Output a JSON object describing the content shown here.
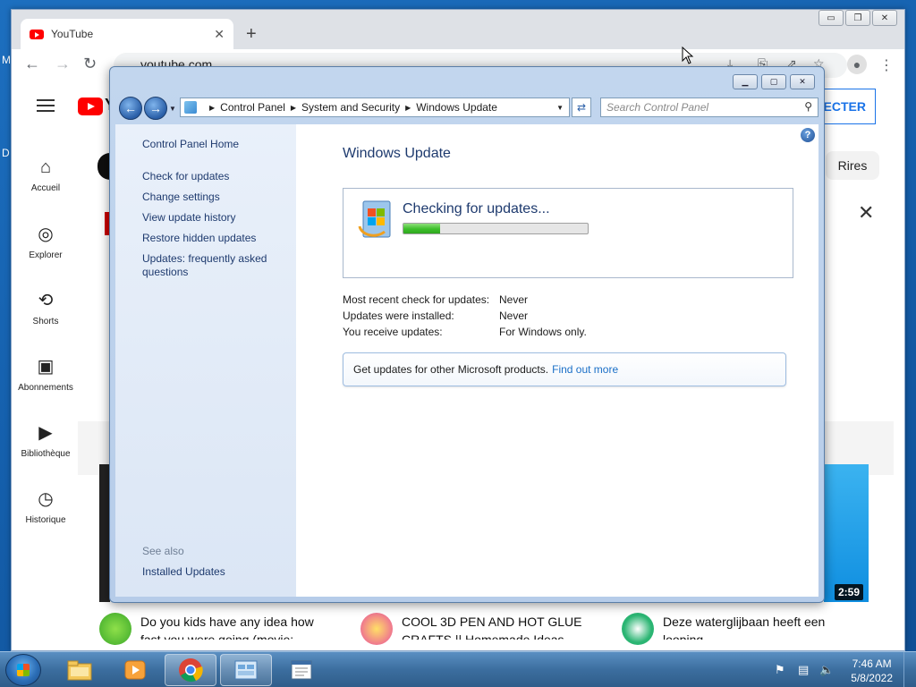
{
  "desktop": {
    "left_letter_1": "M",
    "left_letter_2": "D"
  },
  "browser": {
    "tab_title": "YouTube",
    "tab_close": "✕",
    "new_tab": "+",
    "url": "youtube.com",
    "caption": {
      "minimize": "▭",
      "restore": "❐",
      "close": "✕"
    }
  },
  "youtube": {
    "logo_letter": "Y",
    "connect_label": "ECTER",
    "chip_label": "Rires",
    "sidebar": [
      {
        "label": "Accueil",
        "icon": "home-icon"
      },
      {
        "label": "Explorer",
        "icon": "compass-icon"
      },
      {
        "label": "Shorts",
        "icon": "shorts-icon"
      },
      {
        "label": "Abonnements",
        "icon": "subscriptions-icon"
      },
      {
        "label": "Bibliothèque",
        "icon": "library-icon"
      },
      {
        "label": "Historique",
        "icon": "history-icon"
      }
    ],
    "video_duration": "2:59",
    "videos": [
      {
        "title": "Do you kids have any idea how fast you were going (movie:"
      },
      {
        "title": "COOL 3D PEN AND HOT GLUE CRAFTS || Homemade Ideas"
      },
      {
        "title": "Deze waterglijbaan heeft een looping"
      }
    ]
  },
  "control_panel": {
    "breadcrumb": [
      "Control Panel",
      "System and Security",
      "Windows Update"
    ],
    "search_placeholder": "Search Control Panel",
    "left_links": [
      "Control Panel Home",
      "Check for updates",
      "Change settings",
      "View update history",
      "Restore hidden updates",
      "Updates: frequently asked questions"
    ],
    "see_also_label": "See also",
    "see_also_links": [
      "Installed Updates"
    ],
    "title": "Windows Update",
    "status_text": "Checking for updates...",
    "progress_fraction": 0.2,
    "info": [
      {
        "label": "Most recent check for updates:",
        "value": "Never"
      },
      {
        "label": "Updates were installed:",
        "value": "Never"
      },
      {
        "label": "You receive updates:",
        "value": "For Windows only."
      }
    ],
    "promo_text": "Get updates for other Microsoft products.",
    "promo_link": "Find out more"
  },
  "taskbar": {
    "clock_time": "7:46 AM",
    "clock_date": "5/8/2022",
    "apps": [
      "explorer-icon",
      "media-player-icon",
      "chrome-icon",
      "control-panel-icon",
      "notepad-icon"
    ]
  }
}
